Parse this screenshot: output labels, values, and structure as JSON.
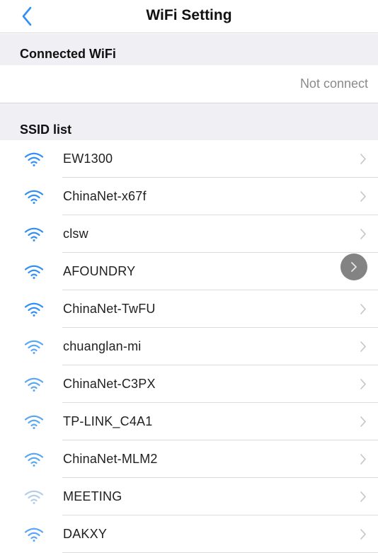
{
  "navbar": {
    "title": "WiFi Setting",
    "back_icon": "chevron-left-icon"
  },
  "connected": {
    "header": "Connected WiFi",
    "status": "Not connect"
  },
  "ssid": {
    "header": "SSID list",
    "items": [
      {
        "name": "EW1300",
        "signal": "strong"
      },
      {
        "name": "ChinaNet-x67f",
        "signal": "strong"
      },
      {
        "name": "clsw",
        "signal": "strong"
      },
      {
        "name": "AFOUNDRY",
        "signal": "strong"
      },
      {
        "name": "ChinaNet-TwFU",
        "signal": "strong"
      },
      {
        "name": "chuanglan-mi",
        "signal": "medium"
      },
      {
        "name": "ChinaNet-C3PX",
        "signal": "medium"
      },
      {
        "name": "TP-LINK_C4A1",
        "signal": "medium"
      },
      {
        "name": "ChinaNet-MLM2",
        "signal": "medium"
      },
      {
        "name": "MEETING",
        "signal": "weak"
      },
      {
        "name": "DAKXY",
        "signal": "medium"
      }
    ]
  },
  "colors": {
    "accent": "#2f8ff5",
    "wifi_weak": "#b5cdea",
    "separator": "#dcdcdc",
    "section_bg": "#efeff4",
    "chevron": "#c4c4c4",
    "status_text": "#8a8a8a"
  }
}
